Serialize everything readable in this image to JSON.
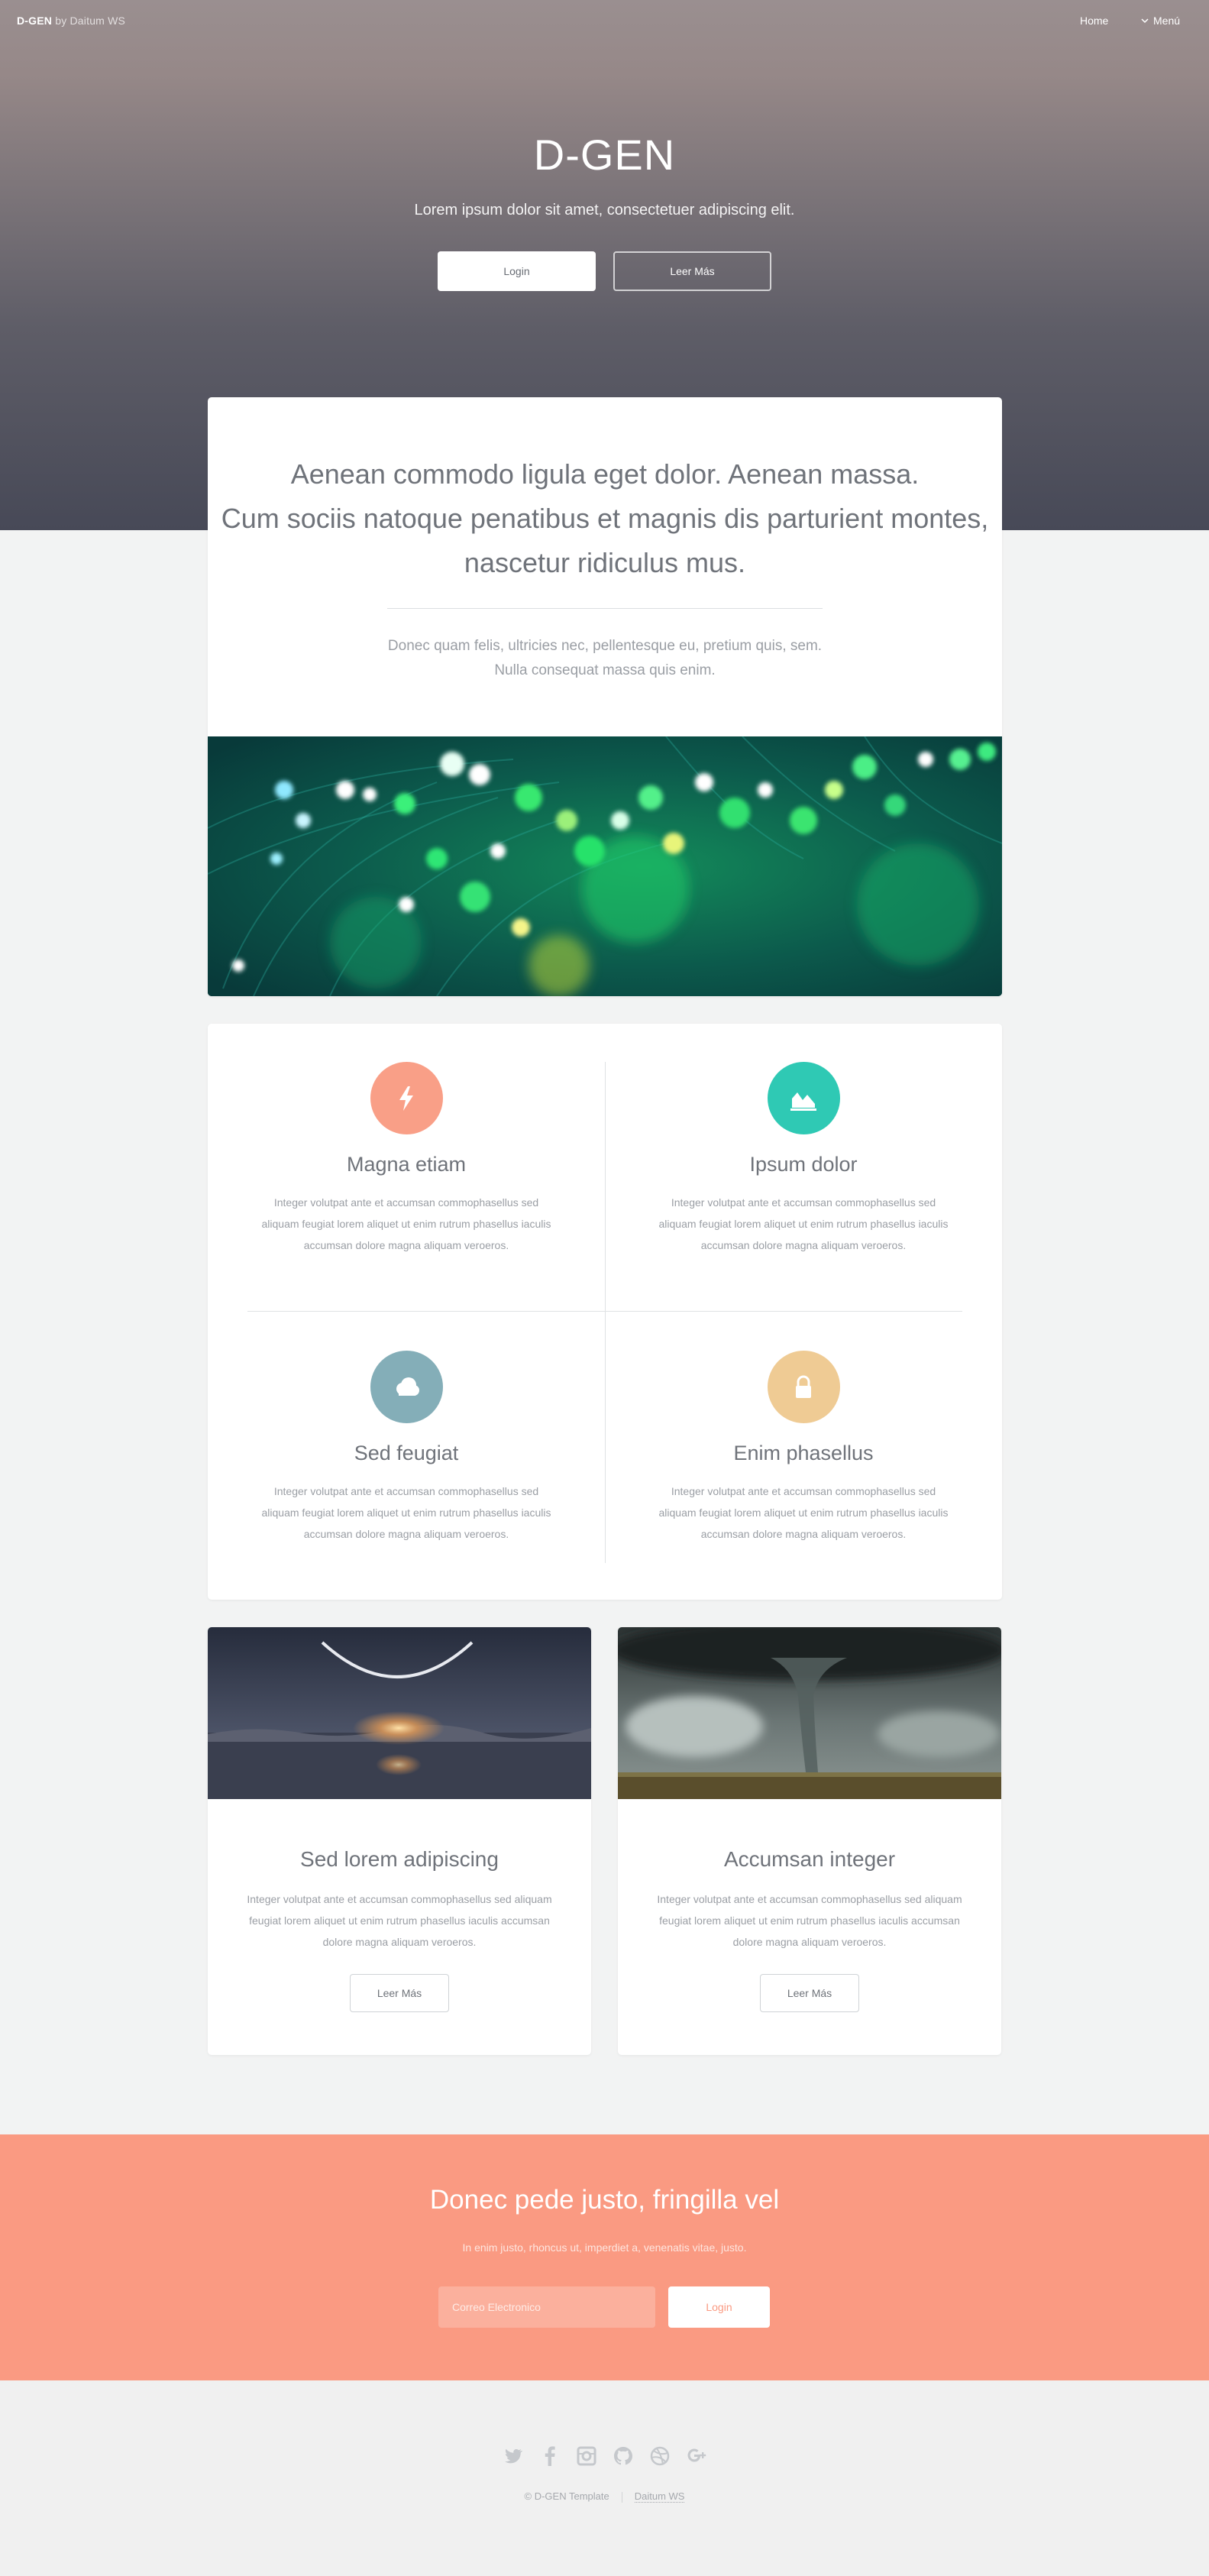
{
  "header": {
    "brand": "D-GEN",
    "brand_by": "by Daitum WS",
    "nav_home": "Home",
    "nav_menu": "Menú"
  },
  "hero": {
    "title": "D-GEN",
    "subtitle": "Lorem ipsum dolor sit amet, consectetuer adipiscing elit.",
    "login_label": "Login",
    "more_label": "Leer Más"
  },
  "intro": {
    "lead_line1": "Aenean commodo ligula eget dolor. Aenean massa.",
    "lead_line2": "Cum sociis natoque penatibus et magnis dis parturient montes,",
    "lead_line3": "nascetur ridiculus mus.",
    "small_line1": "Donec quam felis, ultricies nec, pellentesque eu, pretium quis, sem.",
    "small_line2": "Nulla consequat massa quis enim."
  },
  "features": [
    {
      "title": "Magna etiam",
      "icon": "bolt-icon",
      "color": "#f99f87",
      "text": "Integer volutpat ante et accumsan commophasellus sed aliquam feugiat lorem aliquet ut enim rutrum phasellus iaculis accumsan dolore magna aliquam veroeros."
    },
    {
      "title": "Ipsum dolor",
      "icon": "area-chart-icon",
      "color": "#2fc9b4",
      "text": "Integer volutpat ante et accumsan commophasellus sed aliquam feugiat lorem aliquet ut enim rutrum phasellus iaculis accumsan dolore magna aliquam veroeros."
    },
    {
      "title": "Sed feugiat",
      "icon": "cloud-icon",
      "color": "#84aeb8",
      "text": "Integer volutpat ante et accumsan commophasellus sed aliquam feugiat lorem aliquet ut enim rutrum phasellus iaculis accumsan dolore magna aliquam veroeros."
    },
    {
      "title": "Enim phasellus",
      "icon": "lock-icon",
      "color": "#efcb94",
      "text": "Integer volutpat ante et accumsan commophasellus sed aliquam feugiat lorem aliquet ut enim rutrum phasellus iaculis accumsan dolore magna aliquam veroeros."
    }
  ],
  "posts": [
    {
      "title": "Sed lorem adipiscing",
      "text": "Integer volutpat ante et accumsan commophasellus sed aliquam feugiat lorem aliquet ut enim rutrum phasellus iaculis accumsan dolore magna aliquam veroeros.",
      "button": "Leer Más"
    },
    {
      "title": "Accumsan integer",
      "text": "Integer volutpat ante et accumsan commophasellus sed aliquam feugiat lorem aliquet ut enim rutrum phasellus iaculis accumsan dolore magna aliquam veroeros.",
      "button": "Leer Más"
    }
  ],
  "cta": {
    "title": "Donec pede justo, fringilla vel",
    "subtitle": "In enim justo, rhoncus ut, imperdiet a, venenatis vitae, justo.",
    "email_placeholder": "Correo Electronico",
    "button": "Login",
    "accent": "#fa9a82"
  },
  "footer": {
    "social_icons": [
      "twitter-icon",
      "facebook-icon",
      "instagram-icon",
      "github-icon",
      "dribbble-icon",
      "google-plus-icon"
    ],
    "copyright": "© D-GEN Template",
    "credit": "Daitum WS"
  }
}
